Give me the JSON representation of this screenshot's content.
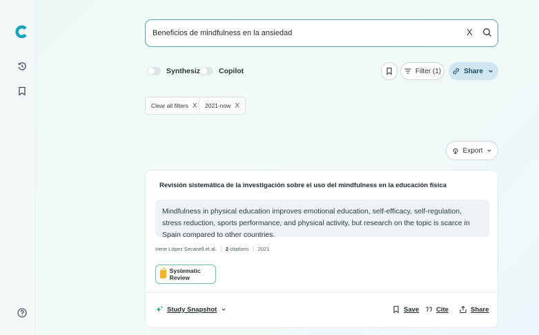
{
  "search": {
    "value": "Beneficios de mindfulness en la ansiedad",
    "clear_glyph": "X"
  },
  "toggles": {
    "synthesize": "Synthesize",
    "copilot": "Copilot"
  },
  "toolbar": {
    "filter_label": "Filter (1)",
    "share_label": "Share"
  },
  "filters": {
    "clear_all": "Clear all filters",
    "active": "2021-now",
    "x": "X"
  },
  "export_label": "Export",
  "result": {
    "title": "Revisión sistemática de la investigación sobre el uso del mindfulness en la educación física",
    "summary": "Mindfulness in physical education improves emotional education, self-efficacy, self-regulation, stress reduction, sports performance, and physical activity, but research on the topic is scarce in Spain compared to other countries.",
    "authors": "Irene López Secanell et al.",
    "citations_count": "2",
    "citations_label": "citations",
    "year": "2021",
    "badge": "Systematic Review",
    "snapshot": "Study Snapshot",
    "save": "Save",
    "cite": "Cite",
    "share": "Share"
  },
  "colors": {
    "accent": "#5da3b4",
    "share_bg": "#cfe6f3",
    "badge_border": "#6cbfa3",
    "logo": "#17a6b8"
  },
  "icons": [
    "logo-icon",
    "history-icon",
    "bookmark-icon",
    "help-icon",
    "search-icon",
    "filter-icon",
    "share-icon",
    "export-icon",
    "sparkle-icon",
    "cite-icon"
  ]
}
